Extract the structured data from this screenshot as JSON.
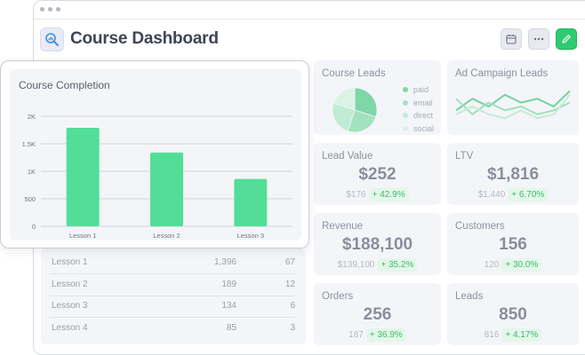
{
  "app": {
    "title": "Course Dashboard"
  },
  "toolbar": {
    "calendar_icon": "calendar-icon",
    "more_icon": "more-icon",
    "edit_icon": "pencil-icon"
  },
  "colors": {
    "accent_green": "#2ecc71",
    "bar_green": "#52de97",
    "delta_green": "#3dbb6d"
  },
  "course_completion": {
    "title": "Course Completion",
    "chart_data": {
      "type": "bar",
      "categories": [
        "Lesson 1",
        "Lesson 2",
        "Lesson 3"
      ],
      "values": [
        1790,
        1340,
        860
      ],
      "yticks": [
        "2K",
        "1.5K",
        "1K",
        "500",
        "0"
      ],
      "ytick_values": [
        2000,
        1500,
        1000,
        500,
        0
      ],
      "ylim": [
        0,
        2000
      ],
      "grid": true
    }
  },
  "course_leads": {
    "title": "Course Leads",
    "chart_data": {
      "type": "pie",
      "labels": [
        "paid",
        "email",
        "direct",
        "social"
      ],
      "values": [
        30,
        25,
        25,
        20
      ],
      "colors": [
        "#7fd6a7",
        "#a2e2bf",
        "#c0ecd4",
        "#daf3e5"
      ]
    }
  },
  "ad_campaign": {
    "title": "Ad Campaign Leads",
    "chart_data": {
      "type": "line",
      "series": [
        {
          "values": [
            4,
            7,
            5,
            8,
            6,
            7,
            5,
            9
          ]
        },
        {
          "values": [
            7,
            3,
            6,
            4,
            5,
            3,
            4,
            6
          ]
        },
        {
          "values": [
            3,
            5,
            3,
            2,
            4,
            2,
            3,
            8
          ]
        }
      ],
      "colors": [
        "#6fd49b",
        "#9fe0bd",
        "#c3ecd6"
      ]
    }
  },
  "metrics": [
    {
      "title": "Lead Value",
      "value": "$252",
      "prev": "$176",
      "delta": "+ 42.9%"
    },
    {
      "title": "LTV",
      "value": "$1,816",
      "prev": "$1,440",
      "delta": "+ 6.70%"
    },
    {
      "title": "Revenue",
      "value": "$188,100",
      "prev": "$139,100",
      "delta": "+ 35.2%"
    },
    {
      "title": "Customers",
      "value": "156",
      "prev": "120",
      "delta": "+ 30.0%"
    },
    {
      "title": "Orders",
      "value": "256",
      "prev": "187",
      "delta": "+ 36.9%"
    },
    {
      "title": "Leads",
      "value": "850",
      "prev": "816",
      "delta": "+ 4.17%"
    }
  ],
  "lessons_table": {
    "rows": [
      {
        "name": "Lesson 1",
        "a": "1,396",
        "b": "67"
      },
      {
        "name": "Lesson 2",
        "a": "189",
        "b": "12"
      },
      {
        "name": "Lesson 3",
        "a": "134",
        "b": "6"
      },
      {
        "name": "Lesson 4",
        "a": "85",
        "b": "3"
      }
    ]
  }
}
